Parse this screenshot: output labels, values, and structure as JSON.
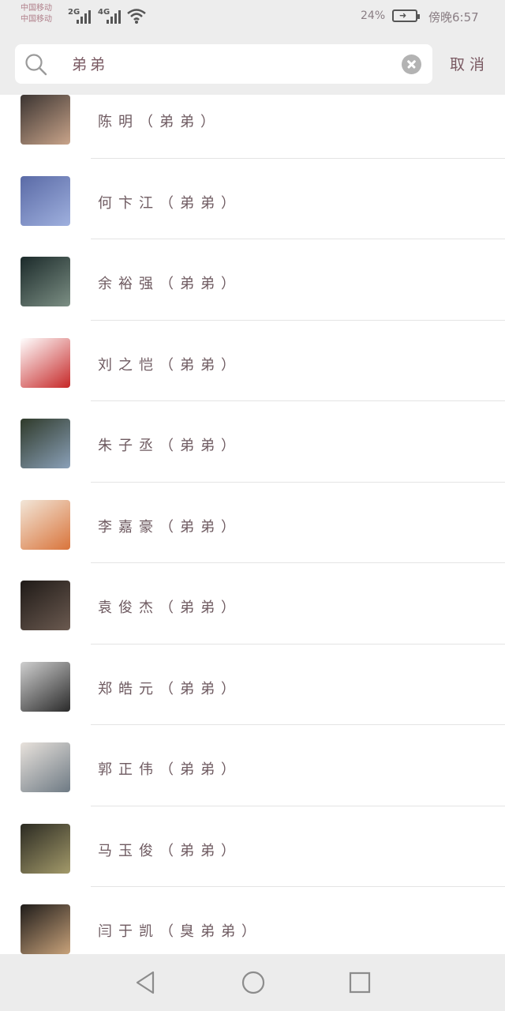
{
  "status": {
    "carrier_top": "中国移动",
    "carrier_bottom": "中国移动",
    "net1": "2G",
    "net2": "4G",
    "battery_pct": "24%",
    "time": "傍晚6:57"
  },
  "search": {
    "query": "弟弟",
    "cancel_label": "取消"
  },
  "contacts": [
    {
      "name": "陈明（弟弟）",
      "avatar_colors": [
        "#3b3431",
        "#c9a48a"
      ]
    },
    {
      "name": "何卞江（弟弟）",
      "avatar_colors": [
        "#5a6aa6",
        "#9fb0de"
      ]
    },
    {
      "name": "余裕强（弟弟）",
      "avatar_colors": [
        "#1b2a2a",
        "#7c8f84"
      ]
    },
    {
      "name": "刘之恺（弟弟）",
      "avatar_colors": [
        "#ffffff",
        "#c62828"
      ]
    },
    {
      "name": "朱子丞（弟弟）",
      "avatar_colors": [
        "#2f3a2a",
        "#8aa0b8"
      ]
    },
    {
      "name": "李嘉豪（弟弟）",
      "avatar_colors": [
        "#f2e6d8",
        "#d9743b"
      ]
    },
    {
      "name": "袁俊杰（弟弟）",
      "avatar_colors": [
        "#1f1a17",
        "#6b5a50"
      ]
    },
    {
      "name": "郑皓元（弟弟）",
      "avatar_colors": [
        "#cfcfcf",
        "#2a2a2a"
      ]
    },
    {
      "name": "郭正伟（弟弟）",
      "avatar_colors": [
        "#e8e2dc",
        "#6e7a84"
      ]
    },
    {
      "name": "马玉俊（弟弟）",
      "avatar_colors": [
        "#2b2a22",
        "#a39a6a"
      ]
    },
    {
      "name": "闫于凯（臭弟弟）",
      "avatar_colors": [
        "#1f1c1a",
        "#c8a27a"
      ]
    }
  ],
  "icons": {
    "search": "search-icon",
    "clear": "clear-icon",
    "back": "back-triangle-icon",
    "home": "home-circle-icon",
    "recents": "recents-square-icon"
  }
}
